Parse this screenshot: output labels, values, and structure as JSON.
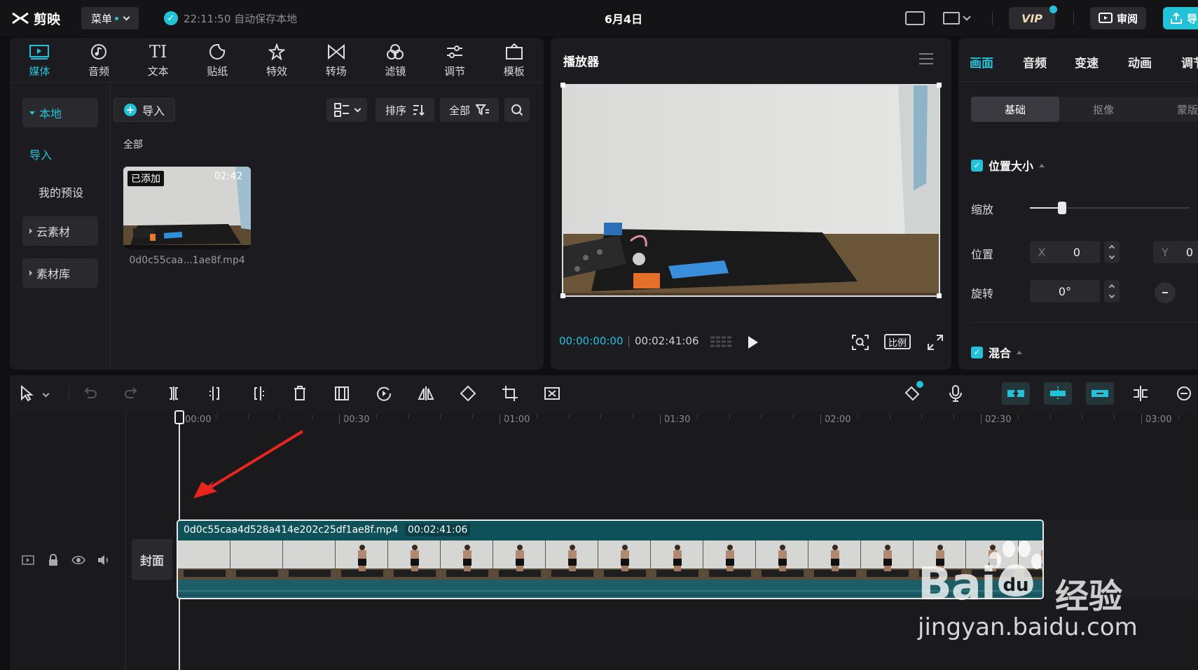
{
  "topbar": {
    "app_name": "剪映",
    "menu_label": "菜单",
    "autosave_text": "22:11:50 自动保存本地",
    "date": "6月4日",
    "vip_label": "VIP",
    "review_label": "审阅",
    "export_label": "导"
  },
  "media": {
    "tabs": [
      {
        "label": "媒体",
        "icon": "media-icon",
        "active": true
      },
      {
        "label": "音频",
        "icon": "audio-icon"
      },
      {
        "label": "文本",
        "icon": "text-icon"
      },
      {
        "label": "贴纸",
        "icon": "sticker-icon"
      },
      {
        "label": "特效",
        "icon": "effects-icon"
      },
      {
        "label": "转场",
        "icon": "transition-icon"
      },
      {
        "label": "滤镜",
        "icon": "filter-icon"
      },
      {
        "label": "调节",
        "icon": "adjust-icon"
      },
      {
        "label": "模板",
        "icon": "template-icon"
      }
    ],
    "side": {
      "local": "本地",
      "import": "导入",
      "my_presets": "我的预设",
      "cloud": "云素材",
      "library": "素材库"
    },
    "import_button": "导入",
    "sort_label": "排序",
    "filter_label": "全部",
    "section_label": "全部",
    "item": {
      "badge": "已添加",
      "duration": "02:42",
      "filename": "0d0c55caa...1ae8f.mp4"
    }
  },
  "player": {
    "title": "播放器",
    "current_time": "00:00:00:00",
    "total_time": "00:02:41:06",
    "ratio_label": "比例"
  },
  "inspector": {
    "tabs": [
      "画面",
      "音频",
      "变速",
      "动画",
      "调节"
    ],
    "subtabs": [
      "基础",
      "抠像",
      "蒙版"
    ],
    "position_size_label": "位置大小",
    "scale_label": "缩放",
    "scale_value": 0.2,
    "position_label": "位置",
    "x_label": "X",
    "x_value": "0",
    "y_label": "Y",
    "y_value": "0",
    "rotation_label": "旋转",
    "rotation_value": "0°",
    "blend_label": "混合"
  },
  "timeline": {
    "ruler": [
      "00:00",
      "00:30",
      "01:00",
      "01:30",
      "02:00",
      "02:30",
      "03:00"
    ],
    "cover_label": "封面",
    "clip_name": "0d0c55caa4d528a414e202c25df1ae8f.mp4",
    "clip_duration": "00:02:41:06"
  },
  "watermark": {
    "brand": "Bai",
    "brand2": "经验",
    "url": "jingyan.baidu.com"
  },
  "colors": {
    "accent": "#22c3d8",
    "clip": "#0e5158",
    "arrow": "#e8261f"
  }
}
